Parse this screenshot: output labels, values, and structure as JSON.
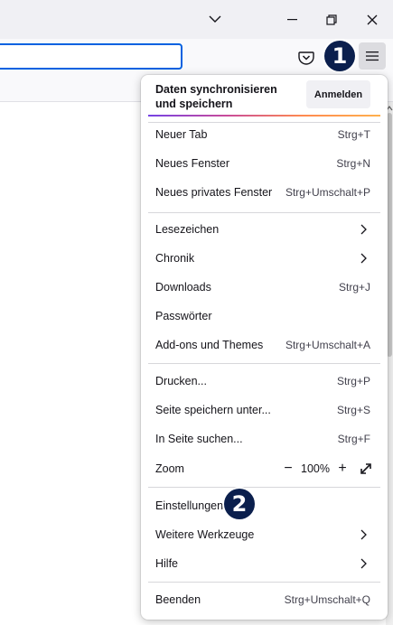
{
  "toolbar": {
    "pocket_icon": "pocket-icon",
    "menu_icon": "hamburger-menu-icon"
  },
  "badges": {
    "one": "1",
    "two": "2"
  },
  "menu": {
    "sync": {
      "text": "Daten synchronisieren und speichern",
      "button": "Anmelden"
    },
    "new_tab": {
      "label": "Neuer Tab",
      "shortcut": "Strg+T"
    },
    "new_window": {
      "label": "Neues Fenster",
      "shortcut": "Strg+N"
    },
    "private_window": {
      "label": "Neues privates Fenster",
      "shortcut": "Strg+Umschalt+P"
    },
    "bookmarks": {
      "label": "Lesezeichen"
    },
    "history": {
      "label": "Chronik"
    },
    "downloads": {
      "label": "Downloads",
      "shortcut": "Strg+J"
    },
    "passwords": {
      "label": "Passwörter"
    },
    "addons": {
      "label": "Add-ons und Themes",
      "shortcut": "Strg+Umschalt+A"
    },
    "print": {
      "label": "Drucken...",
      "shortcut": "Strg+P"
    },
    "save_page": {
      "label": "Seite speichern unter...",
      "shortcut": "Strg+S"
    },
    "find": {
      "label": "In Seite suchen...",
      "shortcut": "Strg+F"
    },
    "zoom": {
      "label": "Zoom",
      "minus": "−",
      "value": "100%",
      "plus": "+"
    },
    "settings": {
      "label": "Einstellungen"
    },
    "more_tools": {
      "label": "Weitere Werkzeuge"
    },
    "help": {
      "label": "Hilfe"
    },
    "quit": {
      "label": "Beenden",
      "shortcut": "Strg+Umschalt+Q"
    }
  },
  "colors": {
    "accent": "#0061e0",
    "badge_bg": "#0b1f4d",
    "sync_gradient": [
      "#7542e5",
      "#ff8a50"
    ]
  }
}
